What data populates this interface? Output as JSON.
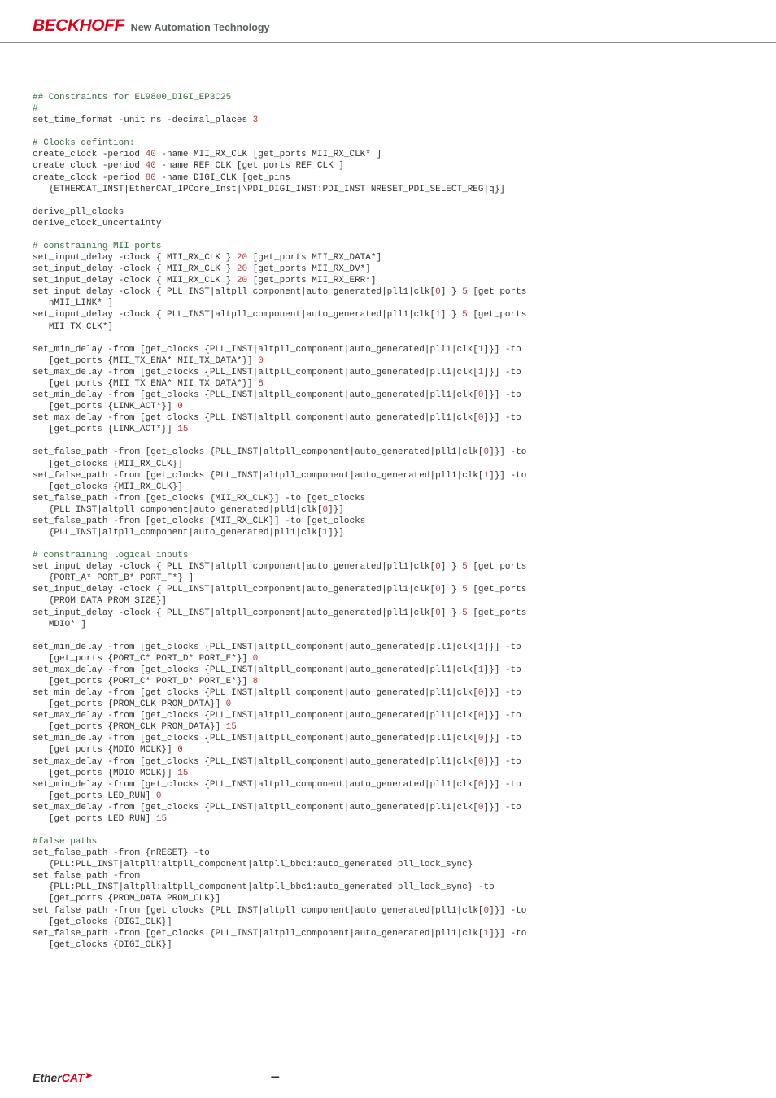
{
  "header": {
    "logo_main": "BECKHOFF",
    "logo_tagline": "New Automation Technology"
  },
  "code": {
    "l1": "## Constraints for EL9800_DIGI_EP3C25",
    "l2": "#",
    "l3_a": "set_time_format -unit ns -decimal_places ",
    "l3_b": "3",
    "l4": "# Clocks defintion:",
    "l5_a": "create_clock -period ",
    "l5_b": "40",
    "l5_c": " -name MII_RX_CLK [get_ports MII_RX_CLK* ]",
    "l6_a": "create_clock -period ",
    "l6_b": "40",
    "l6_c": " -name REF_CLK [get_ports REF_CLK ]",
    "l7_a": "create_clock -period ",
    "l7_b": "80",
    "l7_c": " -name DIGI_CLK [get_pins",
    "l8": "   {ETHERCAT_INST|EtherCAT_IPCore_Inst|\\PDI_DIGI_INST:PDI_INST|NRESET_PDI_SELECT_REG|q}]",
    "l9": "derive_pll_clocks",
    "l10": "derive_clock_uncertainty",
    "l11": "# constraining MII ports",
    "l12_a": "set_input_delay -clock { MII_RX_CLK } ",
    "l12_b": "20",
    "l12_c": " [get_ports MII_RX_DATA*]",
    "l13_a": "set_input_delay -clock { MII_RX_CLK } ",
    "l13_b": "20",
    "l13_c": " [get_ports MII_RX_DV*]",
    "l14_a": "set_input_delay -clock { MII_RX_CLK } ",
    "l14_b": "20",
    "l14_c": " [get_ports MII_RX_ERR*]",
    "l15_a": "set_input_delay -clock { PLL_INST|altpll_component|auto_generated|pll1|clk[",
    "l15_b": "0",
    "l15_c": "] } ",
    "l15_d": "5",
    "l15_e": " [get_ports\n   nMII_LINK* ]",
    "l16_a": "set_input_delay -clock { PLL_INST|altpll_component|auto_generated|pll1|clk[",
    "l16_b": "1",
    "l16_c": "] } ",
    "l16_d": "5",
    "l16_e": " [get_ports\n   MII_TX_CLK*]",
    "l17_a": "set_min_delay -from [get_clocks {PLL_INST|altpll_component|auto_generated|pll1|clk[",
    "l17_b": "1",
    "l17_c": "]}] -to\n   [get_ports {MII_TX_ENA* MII_TX_DATA*}] ",
    "l17_d": "0",
    "l18_a": "set_max_delay -from [get_clocks {PLL_INST|altpll_component|auto_generated|pll1|clk[",
    "l18_b": "1",
    "l18_c": "]}] -to\n   [get_ports {MII_TX_ENA* MII_TX_DATA*}] ",
    "l18_d": "8",
    "l19_a": "set_min_delay -from [get_clocks {PLL_INST|altpll_component|auto_generated|pll1|clk[",
    "l19_b": "0",
    "l19_c": "]}] -to\n   [get_ports {LINK_ACT*}] ",
    "l19_d": "0",
    "l20_a": "set_max_delay -from [get_clocks {PLL_INST|altpll_component|auto_generated|pll1|clk[",
    "l20_b": "0",
    "l20_c": "]}] -to\n   [get_ports {LINK_ACT*}] ",
    "l20_d": "15",
    "l21_a": "set_false_path -from [get_clocks {PLL_INST|altpll_component|auto_generated|pll1|clk[",
    "l21_b": "0",
    "l21_c": "]}] -to\n   [get_clocks {MII_RX_CLK}]",
    "l22_a": "set_false_path -from [get_clocks {PLL_INST|altpll_component|auto_generated|pll1|clk[",
    "l22_b": "1",
    "l22_c": "]}] -to\n   [get_clocks {MII_RX_CLK}]",
    "l23_a": "set_false_path -from [get_clocks {MII_RX_CLK}] -to [get_clocks\n   {PLL_INST|altpll_component|auto_generated|pll1|clk[",
    "l23_b": "0",
    "l23_c": "]}]",
    "l24_a": "set_false_path -from [get_clocks {MII_RX_CLK}] -to [get_clocks\n   {PLL_INST|altpll_component|auto_generated|pll1|clk[",
    "l24_b": "1",
    "l24_c": "]}]",
    "l25": "# constraining logical inputs",
    "l26_a": "set_input_delay -clock { PLL_INST|altpll_component|auto_generated|pll1|clk[",
    "l26_b": "0",
    "l26_c": "] } ",
    "l26_d": "5",
    "l26_e": " [get_ports\n   {PORT_A* PORT_B* PORT_F*} ]",
    "l27_a": "set_input_delay -clock { PLL_INST|altpll_component|auto_generated|pll1|clk[",
    "l27_b": "0",
    "l27_c": "] } ",
    "l27_d": "5",
    "l27_e": " [get_ports\n   {PROM_DATA PROM_SIZE}]",
    "l28_a": "set_input_delay -clock { PLL_INST|altpll_component|auto_generated|pll1|clk[",
    "l28_b": "0",
    "l28_c": "] } ",
    "l28_d": "5",
    "l28_e": " [get_ports\n   MDIO* ]",
    "l29_a": "set_min_delay -from [get_clocks {PLL_INST|altpll_component|auto_generated|pll1|clk[",
    "l29_b": "1",
    "l29_c": "]}] -to\n   [get_ports {PORT_C* PORT_D* PORT_E*}] ",
    "l29_d": "0",
    "l30_a": "set_max_delay -from [get_clocks {PLL_INST|altpll_component|auto_generated|pll1|clk[",
    "l30_b": "1",
    "l30_c": "]}] -to\n   [get_ports {PORT_C* PORT_D* PORT_E*}] ",
    "l30_d": "8",
    "l31_a": "set_min_delay -from [get_clocks {PLL_INST|altpll_component|auto_generated|pll1|clk[",
    "l31_b": "0",
    "l31_c": "]}] -to\n   [get_ports {PROM_CLK PROM_DATA}] ",
    "l31_d": "0",
    "l32_a": "set_max_delay -from [get_clocks {PLL_INST|altpll_component|auto_generated|pll1|clk[",
    "l32_b": "0",
    "l32_c": "]}] -to\n   [get_ports {PROM_CLK PROM_DATA}] ",
    "l32_d": "15",
    "l33_a": "set_min_delay -from [get_clocks {PLL_INST|altpll_component|auto_generated|pll1|clk[",
    "l33_b": "0",
    "l33_c": "]}] -to\n   [get_ports {MDIO MCLK}] ",
    "l33_d": "0",
    "l34_a": "set_max_delay -from [get_clocks {PLL_INST|altpll_component|auto_generated|pll1|clk[",
    "l34_b": "0",
    "l34_c": "]}] -to\n   [get_ports {MDIO MCLK}] ",
    "l34_d": "15",
    "l35_a": "set_min_delay -from [get_clocks {PLL_INST|altpll_component|auto_generated|pll1|clk[",
    "l35_b": "0",
    "l35_c": "]}] -to\n   [get_ports LED_RUN] ",
    "l35_d": "0",
    "l36_a": "set_max_delay -from [get_clocks {PLL_INST|altpll_component|auto_generated|pll1|clk[",
    "l36_b": "0",
    "l36_c": "]}] -to\n   [get_ports LED_RUN] ",
    "l36_d": "15",
    "l37": "#false paths",
    "l38": "set_false_path -from {nRESET} -to\n   {PLL:PLL_INST|altpll:altpll_component|altpll_bbc1:auto_generated|pll_lock_sync}",
    "l39": "set_false_path -from\n   {PLL:PLL_INST|altpll:altpll_component|altpll_bbc1:auto_generated|pll_lock_sync} -to\n   [get_ports {PROM_DATA PROM_CLK}]",
    "l40_a": "set_false_path -from [get_clocks {PLL_INST|altpll_component|auto_generated|pll1|clk[",
    "l40_b": "0",
    "l40_c": "]}] -to\n   [get_clocks {DIGI_CLK}]",
    "l41_a": "set_false_path -from [get_clocks {PLL_INST|altpll_component|auto_generated|pll1|clk[",
    "l41_b": "1",
    "l41_c": "]}] -to\n   [get_clocks {DIGI_CLK}]"
  },
  "footer": {
    "ethercat_ether": "Ether",
    "ethercat_cat": "CAT",
    "ethercat_arrow": "➤",
    "dash": "–"
  }
}
